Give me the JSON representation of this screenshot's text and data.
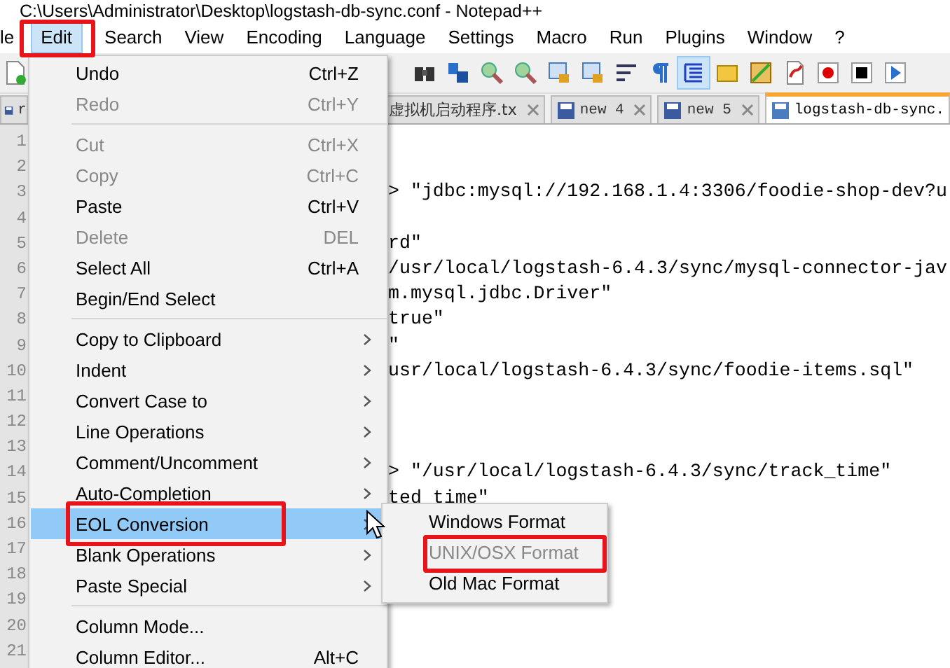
{
  "window": {
    "title": "C:\\Users\\Administrator\\Desktop\\logstash-db-sync.conf - Notepad++"
  },
  "menubar": [
    {
      "label": "le",
      "selected": false,
      "annotated": false
    },
    {
      "label": "Edit",
      "selected": true,
      "annotated": true
    },
    {
      "label": "Search",
      "selected": false,
      "annotated": false
    },
    {
      "label": "View",
      "selected": false,
      "annotated": false
    },
    {
      "label": "Encoding",
      "selected": false,
      "annotated": false
    },
    {
      "label": "Language",
      "selected": false,
      "annotated": false
    },
    {
      "label": "Settings",
      "selected": false,
      "annotated": false
    },
    {
      "label": "Macro",
      "selected": false,
      "annotated": false
    },
    {
      "label": "Run",
      "selected": false,
      "annotated": false
    },
    {
      "label": "Plugins",
      "selected": false,
      "annotated": false
    },
    {
      "label": "Window",
      "selected": false,
      "annotated": false
    },
    {
      "label": "?",
      "selected": false,
      "annotated": false
    }
  ],
  "tabs": [
    {
      "label": "r",
      "selected": false
    },
    {
      "label": "虚拟机启动程序.tx",
      "selected": false
    },
    {
      "label": "new 4",
      "selected": false
    },
    {
      "label": "new 5",
      "selected": false
    },
    {
      "label": "logstash-db-sync.",
      "selected": true
    }
  ],
  "editor": {
    "lines": [
      {
        "number": "1"
      },
      {
        "number": "2"
      },
      {
        "number": "3",
        "text": "> \"jdbc:mysql://192.168.1.4:3306/foodie-shop-dev?u"
      },
      {
        "number": "4"
      },
      {
        "number": "5",
        "text": "rd\""
      },
      {
        "number": "6",
        "text": "/usr/local/logstash-6.4.3/sync/mysql-connector-jav"
      },
      {
        "number": "7",
        "text": "m.mysql.jdbc.Driver\""
      },
      {
        "number": "8",
        "text": "true\""
      },
      {
        "number": "9",
        "text": "\""
      },
      {
        "number": "10",
        "text": "usr/local/logstash-6.4.3/sync/foodie-items.sql\""
      },
      {
        "number": "11"
      },
      {
        "number": "12"
      },
      {
        "number": "13"
      },
      {
        "number": "14",
        "text": "> \"/usr/local/logstash-6.4.3/sync/track_time\""
      },
      {
        "number": "15",
        "text": "ted time\""
      },
      {
        "number": "16"
      },
      {
        "number": "17"
      },
      {
        "number": "18"
      },
      {
        "number": "19"
      },
      {
        "number": "20"
      },
      {
        "number": "21"
      }
    ]
  },
  "edit_menu": [
    {
      "kind": "item",
      "label": "Undo",
      "shortcut": "Ctrl+Z",
      "disabled": false,
      "submenu": false,
      "selected": false,
      "annotated": false
    },
    {
      "kind": "item",
      "label": "Redo",
      "shortcut": "Ctrl+Y",
      "disabled": true,
      "submenu": false,
      "selected": false,
      "annotated": false
    },
    {
      "kind": "separator"
    },
    {
      "kind": "item",
      "label": "Cut",
      "shortcut": "Ctrl+X",
      "disabled": true,
      "submenu": false,
      "selected": false,
      "annotated": false
    },
    {
      "kind": "item",
      "label": "Copy",
      "shortcut": "Ctrl+C",
      "disabled": true,
      "submenu": false,
      "selected": false,
      "annotated": false
    },
    {
      "kind": "item",
      "label": "Paste",
      "shortcut": "Ctrl+V",
      "disabled": false,
      "submenu": false,
      "selected": false,
      "annotated": false
    },
    {
      "kind": "item",
      "label": "Delete",
      "shortcut": "DEL",
      "disabled": true,
      "submenu": false,
      "selected": false,
      "annotated": false
    },
    {
      "kind": "item",
      "label": "Select All",
      "shortcut": "Ctrl+A",
      "disabled": false,
      "submenu": false,
      "selected": false,
      "annotated": false
    },
    {
      "kind": "item",
      "label": "Begin/End Select",
      "disabled": false,
      "submenu": false,
      "selected": false,
      "annotated": false
    },
    {
      "kind": "separator"
    },
    {
      "kind": "item",
      "label": "Copy to Clipboard",
      "disabled": false,
      "submenu": true,
      "selected": false,
      "annotated": false
    },
    {
      "kind": "item",
      "label": "Indent",
      "disabled": false,
      "submenu": true,
      "selected": false,
      "annotated": false
    },
    {
      "kind": "item",
      "label": "Convert Case to",
      "disabled": false,
      "submenu": true,
      "selected": false,
      "annotated": false
    },
    {
      "kind": "item",
      "label": "Line Operations",
      "disabled": false,
      "submenu": true,
      "selected": false,
      "annotated": false
    },
    {
      "kind": "item",
      "label": "Comment/Uncomment",
      "disabled": false,
      "submenu": true,
      "selected": false,
      "annotated": false
    },
    {
      "kind": "item",
      "label": "Auto-Completion",
      "disabled": false,
      "submenu": true,
      "selected": false,
      "annotated": false
    },
    {
      "kind": "item",
      "label": "EOL Conversion",
      "disabled": false,
      "submenu": true,
      "selected": true,
      "annotated": true
    },
    {
      "kind": "item",
      "label": "Blank Operations",
      "disabled": false,
      "submenu": true,
      "selected": false,
      "annotated": false
    },
    {
      "kind": "item",
      "label": "Paste Special",
      "disabled": false,
      "submenu": true,
      "selected": false,
      "annotated": false
    },
    {
      "kind": "separator"
    },
    {
      "kind": "item",
      "label": "Column Mode...",
      "disabled": false,
      "submenu": false,
      "selected": false,
      "annotated": false
    },
    {
      "kind": "item",
      "label": "Column Editor...",
      "shortcut": "Alt+C",
      "disabled": false,
      "submenu": false,
      "selected": false,
      "annotated": false
    }
  ],
  "eol_submenu": [
    {
      "label": "Windows Format",
      "disabled": false,
      "selected": false,
      "annotated": false
    },
    {
      "label": "UNIX/OSX Format",
      "disabled": true,
      "selected": false,
      "annotated": true
    },
    {
      "label": "Old Mac Format",
      "disabled": false,
      "selected": false,
      "annotated": false
    }
  ]
}
